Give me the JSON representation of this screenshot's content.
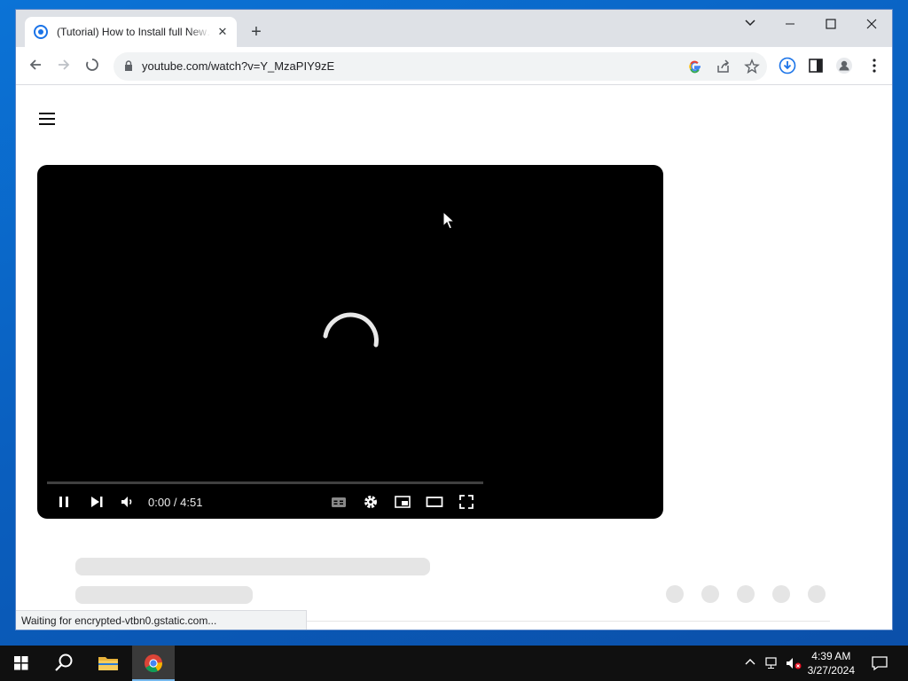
{
  "browser": {
    "tab": {
      "title": "(Tutorial) How to Install full New…",
      "close": "✕"
    },
    "new_tab": "+",
    "window_controls": {
      "tabsearch": "⌄",
      "minimize": "—",
      "maximize": "□",
      "close": "✕"
    },
    "nav": {
      "back": "←",
      "forward": "→",
      "reload": "loading"
    },
    "address": {
      "url": "youtube.com/watch?v=Y_MzaPIY9zE"
    },
    "status": "Waiting for encrypted-vtbn0.gstatic.com..."
  },
  "player": {
    "time": "0:00 / 4:51",
    "controls": [
      "pause-icon",
      "next-icon",
      "volume-icon",
      "captions-icon",
      "settings-icon",
      "miniplayer-icon",
      "theater-icon",
      "fullscreen-icon"
    ]
  },
  "taskbar": {
    "apps": [
      "start-icon",
      "search-icon",
      "file-explorer-icon",
      "chrome-icon"
    ],
    "clock": {
      "time": "4:39 AM",
      "date": "3/27/2024"
    }
  },
  "colors": {
    "accent": "#1a73e8",
    "tabbar": "#dee1e6",
    "desktop": "#0a5fbf"
  }
}
